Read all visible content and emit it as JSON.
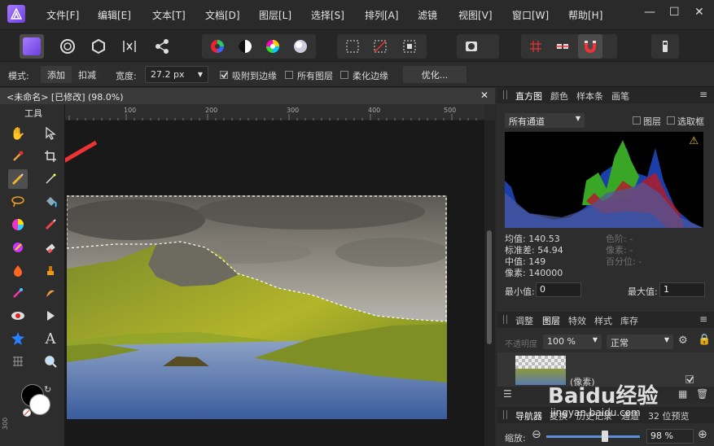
{
  "menubar": {
    "items": [
      "文件[F]",
      "编辑[E]",
      "文本[T]",
      "文档[D]",
      "图层[L]",
      "选择[S]",
      "排列[A]",
      "滤镜",
      "视图[V]",
      "窗口[W]",
      "帮助[H]"
    ],
    "minimize": "—",
    "maximize": "☐",
    "close": "✕"
  },
  "context": {
    "mode_label": "模式:",
    "mode_add": "添加",
    "mode_subtract": "扣减",
    "width_label": "宽度:",
    "width_value": "27.2 px",
    "snap_label": "吸附到边缘",
    "all_layers_label": "所有图层",
    "soft_edge_label": "柔化边缘",
    "optimize_label": "优化..."
  },
  "document": {
    "title": "<未命名> [已修改] (98.0%)",
    "close": "✕"
  },
  "tools": {
    "title": "工具"
  },
  "ruler": {
    "ticks": [
      "100",
      "200",
      "300",
      "400",
      "500"
    ],
    "v_tick": "300"
  },
  "histogram_panel": {
    "tabs": [
      "直方图",
      "颜色",
      "样本条",
      "画笔"
    ],
    "channel": "所有通道",
    "layer_label": "图层",
    "marquee_label": "选取框",
    "stats": {
      "mean": "均值: 140.53",
      "std": "标准差: 54.94",
      "median": "中值: 149",
      "pixels": "像素: 140000",
      "level": "色阶: -",
      "count": "像素: -",
      "percentile": "百分位: -"
    },
    "min_label": "最小值:",
    "min_value": "0",
    "max_label": "最大值:",
    "max_value": "1"
  },
  "layers_panel": {
    "tabs": [
      "调整",
      "图层",
      "特效",
      "样式",
      "库存"
    ],
    "opacity_label": "不透明度",
    "opacity_value": "100 %",
    "blend_mode": "正常",
    "layer_name": "(像素)"
  },
  "navigator_panel": {
    "tabs": [
      "导航器",
      "变换",
      "历史记录",
      "通道",
      "32 位预览"
    ],
    "zoom_label": "缩放:",
    "zoom_value": "98 %"
  },
  "watermark": {
    "brand": "Baidu经验",
    "url": "jingyan.baidu.com"
  }
}
